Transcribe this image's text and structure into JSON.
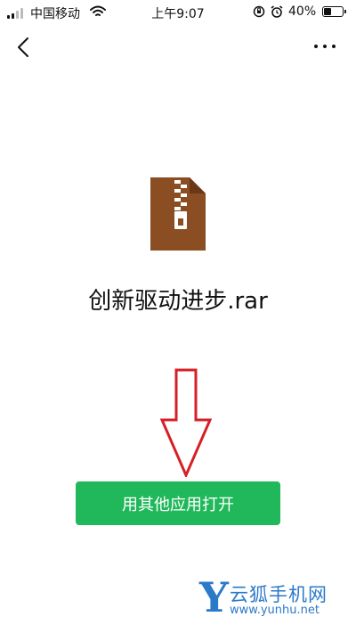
{
  "status_bar": {
    "carrier": "中国移动",
    "time": "上午9:07",
    "battery": "40%",
    "battery_level": 0.4
  },
  "nav": {
    "back_icon": "chevron-left-icon",
    "more_icon": "more-horizontal-icon"
  },
  "file": {
    "name": "创新驱动进步.rar",
    "icon": "archive-file-icon",
    "icon_color": "#8b4d22"
  },
  "annotation": {
    "arrow_color": "#d61f26"
  },
  "actions": {
    "open_with_label": "用其他应用打开",
    "button_color": "#20b85a"
  },
  "watermark": {
    "letter": "Y",
    "title": "云狐手机网",
    "url": "www.yunhu.net",
    "color": "#2b79c9"
  }
}
